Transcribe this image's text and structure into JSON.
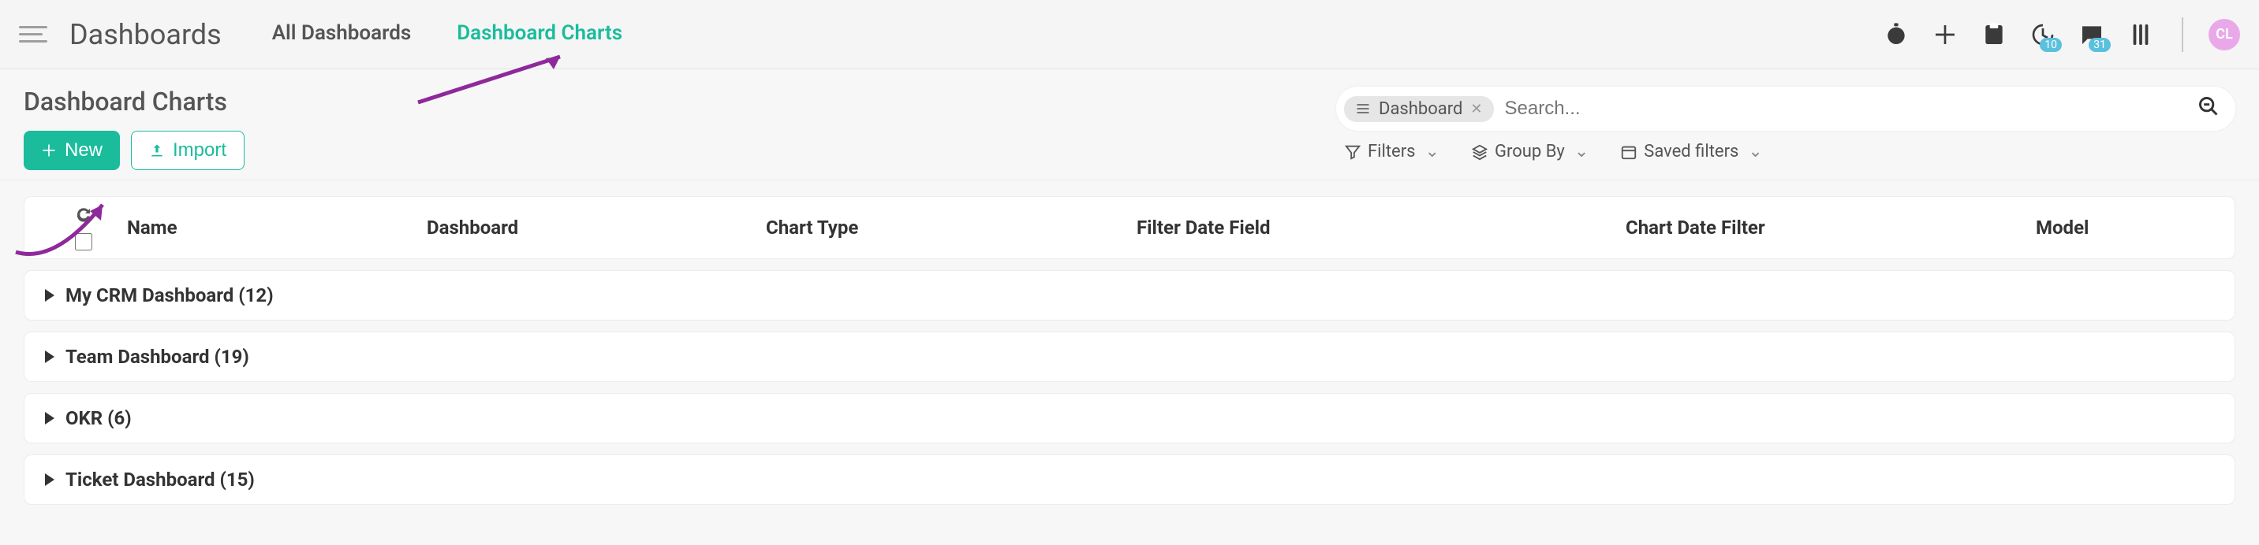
{
  "header": {
    "app_title": "Dashboards",
    "tabs": [
      {
        "label": "All Dashboards",
        "active": false
      },
      {
        "label": "Dashboard Charts",
        "active": true
      }
    ],
    "badge_clock": "10",
    "badge_chat": "31",
    "avatar_initials": "CL"
  },
  "page": {
    "title": "Dashboard Charts",
    "new_label": "New",
    "import_label": "Import"
  },
  "search": {
    "chip_label": "Dashboard",
    "placeholder": "Search..."
  },
  "filters": {
    "filters_label": "Filters",
    "groupby_label": "Group By",
    "saved_label": "Saved filters"
  },
  "table": {
    "columns": {
      "name": "Name",
      "dashboard": "Dashboard",
      "chart_type": "Chart Type",
      "filter_date_field": "Filter Date Field",
      "chart_date_filter": "Chart Date Filter",
      "model": "Model"
    },
    "groups": [
      {
        "label": "My CRM Dashboard (12)"
      },
      {
        "label": "Team Dashboard (19)"
      },
      {
        "label": "OKR (6)"
      },
      {
        "label": "Ticket Dashboard (15)"
      }
    ]
  }
}
